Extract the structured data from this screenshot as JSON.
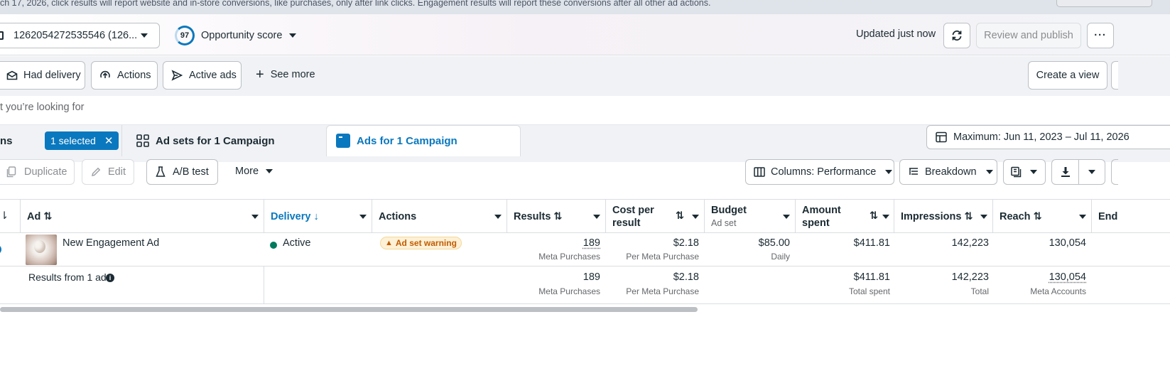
{
  "banner": {
    "text": "ch 17, 2026, click results will report website and in-store conversions, like purchases, only after link clicks. Engagement results will report these conversions after all other ad actions."
  },
  "header": {
    "account_label": "1262054272535546 (126...",
    "opportunity_score": "97",
    "opportunity_label": "Opportunity score",
    "updated_text": "Updated just now",
    "review_publish_label": "Review and publish"
  },
  "filters": {
    "had_delivery": "Had delivery",
    "actions": "Actions",
    "active_ads": "Active ads",
    "see_more": "See more",
    "create_view": "Create a view"
  },
  "search": {
    "placeholder_fragment": "t you’re looking for"
  },
  "tabs": {
    "campaigns_fragment": "ns",
    "selected_badge": "1 selected",
    "ad_sets": "Ad sets for 1 Campaign",
    "ads": "Ads for 1 Campaign",
    "date_range": "Maximum: Jun 11, 2023 – Jul 11, 2026"
  },
  "toolbar": {
    "duplicate": "Duplicate",
    "edit": "Edit",
    "ab_test": "A/B test",
    "more": "More",
    "columns": "Columns: Performance",
    "breakdown": "Breakdown"
  },
  "table": {
    "headers": {
      "ad": "Ad",
      "delivery": "Delivery",
      "actions": "Actions",
      "results": "Results",
      "cost_per_result_1": "Cost per",
      "cost_per_result_2": "result",
      "budget": "Budget",
      "budget_sub": "Ad set",
      "amount_spent_1": "Amount",
      "amount_spent_2": "spent",
      "impressions": "Impressions",
      "reach": "Reach",
      "ends": "End"
    },
    "row": {
      "name": "New Engagement Ad",
      "delivery": "Active",
      "actions_badge": "Ad set warning",
      "results": "189",
      "results_sub": "Meta Purchases",
      "cost": "$2.18",
      "cost_sub": "Per Meta Purchase",
      "budget": "$85.00",
      "budget_sub": "Daily",
      "amount": "$411.81",
      "impressions": "142,223",
      "reach": "130,054"
    },
    "summary": {
      "label": "Results from 1 ad",
      "results": "189",
      "results_sub": "Meta Purchases",
      "cost": "$2.18",
      "cost_sub": "Per Meta Purchase",
      "amount": "$411.81",
      "amount_sub": "Total spent",
      "impressions": "142,223",
      "impressions_sub": "Total",
      "reach": "130,054",
      "reach_sub": "Meta Accounts"
    }
  },
  "colors": {
    "accent": "#0a78be",
    "active_dot": "#007a5c",
    "warning_bg": "#fdf1d6",
    "warning_text": "#c15c00"
  }
}
